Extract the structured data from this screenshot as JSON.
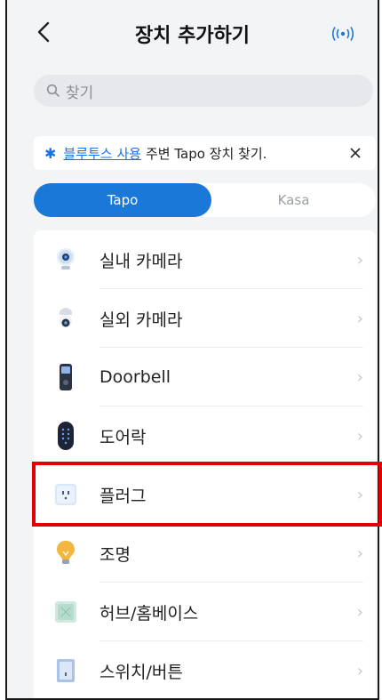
{
  "header": {
    "title": "장치 추가하기"
  },
  "search": {
    "placeholder": "찾기"
  },
  "bluetooth_bar": {
    "link": "블루투스 사용",
    "text": "주변 Tapo 장치 찾기."
  },
  "tabs": [
    {
      "label": "Tapo",
      "active": true
    },
    {
      "label": "Kasa",
      "active": false
    }
  ],
  "devices": [
    {
      "label": "실내 카메라",
      "icon": "indoor-camera-icon"
    },
    {
      "label": "실외 카메라",
      "icon": "outdoor-camera-icon"
    },
    {
      "label": "Doorbell",
      "icon": "doorbell-icon"
    },
    {
      "label": "도어락",
      "icon": "door-lock-icon"
    },
    {
      "label": "플러그",
      "icon": "plug-icon",
      "highlighted": true
    },
    {
      "label": "조명",
      "icon": "bulb-icon"
    },
    {
      "label": "허브/홈베이스",
      "icon": "hub-icon"
    },
    {
      "label": "스위치/버튼",
      "icon": "switch-icon"
    }
  ],
  "colors": {
    "accent": "#1a78d8",
    "highlight": "#e30000"
  }
}
